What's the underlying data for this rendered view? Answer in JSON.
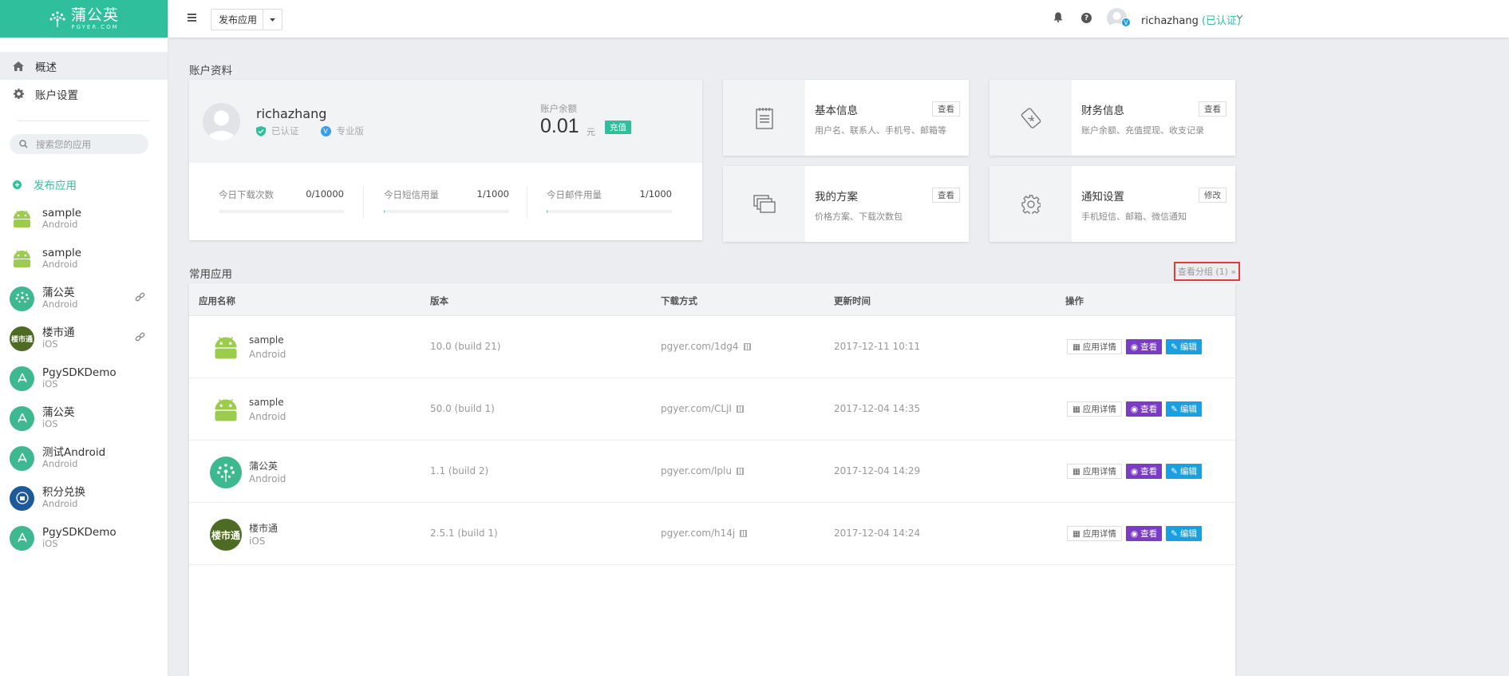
{
  "logo": {
    "title": "蒲公英",
    "subtitle": "PGYER.COM"
  },
  "sidebar": {
    "nav": [
      {
        "label": "概述",
        "icon": "home-icon"
      },
      {
        "label": "账户设置",
        "icon": "gear-icon"
      }
    ],
    "search_placeholder": "搜索您的应用",
    "publish_label": "发布应用",
    "apps": [
      {
        "name": "sample",
        "platform": "Android",
        "icon": "android-icon"
      },
      {
        "name": "sample",
        "platform": "Android",
        "icon": "android-icon"
      },
      {
        "name": "蒲公英",
        "platform": "Android",
        "icon": "dandelion-icon",
        "linked": true
      },
      {
        "name": "楼市通",
        "platform": "iOS",
        "icon": "loushitong-icon",
        "linked": true,
        "icon_text": "楼市通"
      },
      {
        "name": "PgySDKDemo",
        "platform": "iOS",
        "icon": "appstore-icon"
      },
      {
        "name": "蒲公英",
        "platform": "iOS",
        "icon": "appstore-icon"
      },
      {
        "name": "测试Android",
        "platform": "Android",
        "icon": "appstore-icon"
      },
      {
        "name": "积分兑换",
        "platform": "Android",
        "icon": "points-icon"
      },
      {
        "name": "PgySDKDemo",
        "platform": "iOS",
        "icon": "appstore-icon"
      }
    ]
  },
  "topbar": {
    "publish_button": "发布应用",
    "username": "richazhang",
    "verified": "(已认证)",
    "avatar_badge": "V"
  },
  "account": {
    "section_title": "账户资料",
    "name": "richazhang",
    "verified_tag": "已认证",
    "plan_badge": "V",
    "plan_tag": "专业版",
    "balance_label": "账户余额",
    "balance_value": "0.01",
    "balance_unit": "元",
    "recharge_label": "充值",
    "usage": [
      {
        "label": "今日下载次数",
        "value": "0/10000",
        "fraction": 0.0
      },
      {
        "label": "今日短信用量",
        "value": "1/1000",
        "fraction": 0.001
      },
      {
        "label": "今日邮件用量",
        "value": "1/1000",
        "fraction": 0.001
      }
    ]
  },
  "info_cards": [
    {
      "title": "基本信息",
      "desc": "用户名、联系人、手机号、邮箱等",
      "button": "查看",
      "icon": "notepad-icon"
    },
    {
      "title": "财务信息",
      "desc": "账户余额、充值提现、收支记录",
      "button": "查看",
      "icon": "ticket-icon"
    },
    {
      "title": "我的方案",
      "desc": "价格方案、下载次数包",
      "button": "查看",
      "icon": "stack-icon"
    },
    {
      "title": "通知设置",
      "desc": "手机短信、邮箱、微信通知",
      "button": "修改",
      "icon": "gear-icon"
    }
  ],
  "apps_section": {
    "title": "常用应用",
    "view_group": "查看分组 (1) »",
    "headers": [
      "应用名称",
      "版本",
      "下载方式",
      "更新时间",
      "操作"
    ],
    "ops": {
      "detail": "应用详情",
      "view": "查看",
      "edit": "编辑"
    },
    "rows": [
      {
        "name": "sample",
        "platform": "Android",
        "version": "10.0 (build 21)",
        "download": "pgyer.com/1dg4",
        "updated": "2017-12-11 10:11",
        "icon": "android-icon"
      },
      {
        "name": "sample",
        "platform": "Android",
        "version": "50.0 (build 1)",
        "download": "pgyer.com/CLjI",
        "updated": "2017-12-04 14:35",
        "icon": "android-icon"
      },
      {
        "name": "蒲公英",
        "platform": "Android",
        "version": "1.1 (build 2)",
        "download": "pgyer.com/lplu",
        "updated": "2017-12-04 14:29",
        "icon": "dandelion-icon"
      },
      {
        "name": "楼市通",
        "platform": "iOS",
        "version": "2.5.1 (build 1)",
        "download": "pgyer.com/h14j",
        "updated": "2017-12-04 14:24",
        "icon": "loushitong-icon",
        "icon_text": "楼市通"
      }
    ]
  },
  "colors": {
    "brand": "#2fbf9c",
    "view": "#7a3cc4",
    "edit": "#1a9fe0",
    "highlight_box": "#e23a3a"
  }
}
